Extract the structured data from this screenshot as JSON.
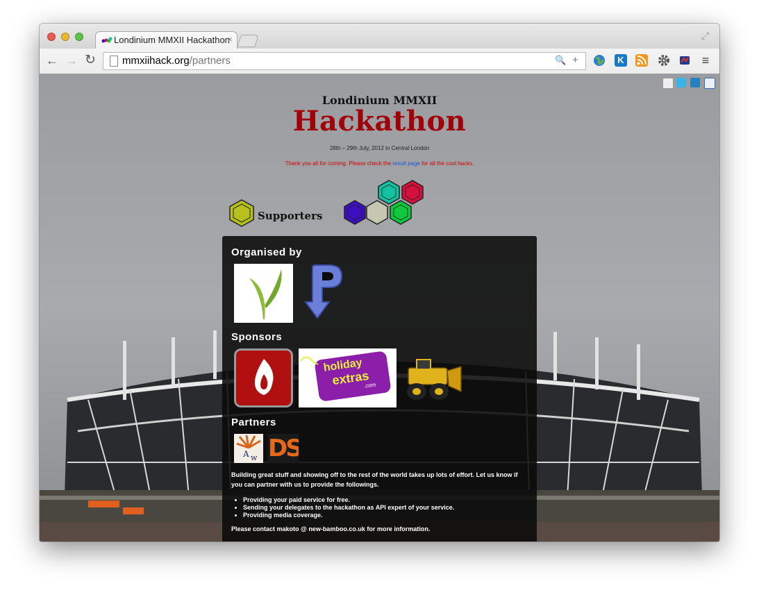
{
  "browser": {
    "tab_title": "Londinium MMXII Hackathon",
    "tab_close": "×",
    "url_domain": "mmxiihack.org",
    "url_path": "/partners",
    "back": "←",
    "forward": "→",
    "reload": "↻",
    "zoom": "🔍",
    "add": "+",
    "fullscreen": "⤢",
    "menu": "≡",
    "ext_k_label": "K"
  },
  "page": {
    "subtitle": "Londinium MMXII",
    "title": "Hackathon",
    "date_line": "28th – 29th July, 2012 in Central London",
    "thanks_before": "Thank you all for coming. Please check the ",
    "thanks_link": "result page",
    "thanks_after": " for all the cool hacks.",
    "supporters_label": "Supporters"
  },
  "panel": {
    "organised_title": "Organised by",
    "sponsors_title": "Sponsors",
    "partners_title": "Partners",
    "sponsor_logo_text": [
      "holiday",
      "extras",
      ".com"
    ],
    "partner_logo_aw": "A",
    "partner_logo_aw2": "w",
    "partner_logo_ds": "DS",
    "intro": "Building great stuff and showing off to the rest of the world takes up lots of effort. Let us know if you can partner with us to provide the followings.",
    "list": [
      "Providing your paid service for free.",
      "Sending your delegates to the hackathon as API expert of your service.",
      "Providing media coverage."
    ],
    "contact": "Please contact makoto @ new-bamboo.co.uk for more information."
  },
  "colors": {
    "title_red": "#a00008",
    "thanks_red": "#d40000",
    "link_blue": "#1c55d8",
    "hex_yellow": "#b8c01e",
    "hex_blue": "#3b0fc0",
    "hex_grey": "#c5c7b0",
    "hex_teal": "#14c2a2",
    "hex_red": "#d5103e",
    "hex_green": "#10c83c"
  },
  "icons": [
    "globe-icon",
    "k-icon",
    "rss-icon",
    "gear-icon",
    "puzzle-icon",
    "menu-icon"
  ]
}
